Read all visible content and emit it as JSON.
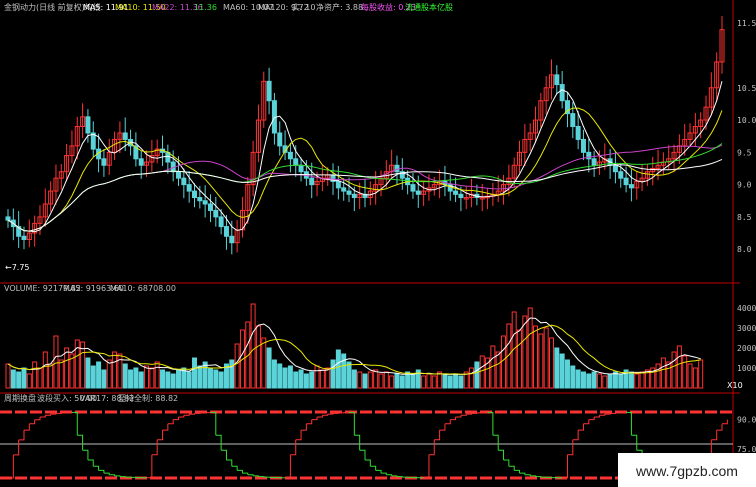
{
  "colors": {
    "bg": "#000000",
    "up": "#ff3333",
    "down": "#5ad3d9",
    "white_line": "#ffffff",
    "yellow_line": "#e8e800",
    "purple_line": "#cc44cc",
    "green_line": "#33dd33",
    "magenta_text": "#ff55ff",
    "green_text": "#33ff33",
    "red_axis": "#c00000",
    "grid": "#800000",
    "label_gray": "#c0c0c0"
  },
  "header_main": {
    "title": "金钢动力(日线 前复权)均线",
    "ma5": "MA5: 11.91",
    "ma10": "MA10: 11.50",
    "ma22": "MA22: 11.36",
    "ma30": "11.36",
    "ma60": "MA60: 10.07",
    "ma120": "MA120: 9.72",
    "extra1": "实: 10",
    "net_asset": "净资产: 3.88",
    "eps": "每股收益: 0.23",
    "float": "流通股本亿股"
  },
  "header_volume": {
    "volume": "VOLUME: 92179.82",
    "ma5": "MA5: 91963.60",
    "ma10": "MA10: 68708.00"
  },
  "header_indicator": {
    "name": "周期换盘",
    "buy": "波段买入: 50.00",
    "var": "VAR17: 88.82",
    "lock": "至持全制: 88.82"
  },
  "low_marker": "7.75",
  "watermark": "www.7gpzb.com",
  "chart_data": [
    {
      "type": "candlestick",
      "name": "price",
      "ylim": [
        7.6,
        11.55
      ],
      "y_ticks": [
        "11.5",
        "10.5",
        "10.0",
        "9.5",
        "9.0",
        "8.5",
        "8.0"
      ],
      "close": [
        8.45,
        8.35,
        8.2,
        8.15,
        8.25,
        8.4,
        8.5,
        8.7,
        8.9,
        9.1,
        9.2,
        9.45,
        9.6,
        9.9,
        10.05,
        9.8,
        9.55,
        9.4,
        9.3,
        9.5,
        9.7,
        9.8,
        9.7,
        9.6,
        9.4,
        9.3,
        9.35,
        9.45,
        9.55,
        9.5,
        9.35,
        9.2,
        9.1,
        9.0,
        8.9,
        8.8,
        8.75,
        8.7,
        8.6,
        8.5,
        8.35,
        8.2,
        8.1,
        8.3,
        8.6,
        9.0,
        9.5,
        10.0,
        10.6,
        10.3,
        9.8,
        9.6,
        9.5,
        9.4,
        9.3,
        9.2,
        9.1,
        9.0,
        9.05,
        9.1,
        9.15,
        9.05,
        8.95,
        8.9,
        8.85,
        8.8,
        8.85,
        8.8,
        8.9,
        9.0,
        9.1,
        9.2,
        9.3,
        9.2,
        9.1,
        9.0,
        8.9,
        8.85,
        8.9,
        8.95,
        9.0,
        9.05,
        9.0,
        8.9,
        8.85,
        8.8,
        8.8,
        8.85,
        8.8,
        8.8,
        8.82,
        8.85,
        8.9,
        9.0,
        9.1,
        9.3,
        9.5,
        9.7,
        9.8,
        10.0,
        10.3,
        10.5,
        10.7,
        10.55,
        10.3,
        10.1,
        9.9,
        9.7,
        9.5,
        9.4,
        9.3,
        9.35,
        9.4,
        9.3,
        9.2,
        9.1,
        9.0,
        8.95,
        9.05,
        9.1,
        9.2,
        9.25,
        9.3,
        9.35,
        9.4,
        9.5,
        9.6,
        9.7,
        9.8,
        9.9,
        10.0,
        10.2,
        10.5,
        10.9,
        11.4
      ]
    },
    {
      "type": "bar",
      "name": "volume",
      "ylim": [
        0,
        4600
      ],
      "y_ticks": [
        "4000",
        "3000",
        "2000",
        "1000"
      ],
      "values": [
        1200,
        900,
        800,
        1000,
        700,
        1300,
        1000,
        1800,
        1200,
        2600,
        1400,
        2000,
        1700,
        2400,
        2300,
        1500,
        1100,
        1300,
        900,
        1400,
        1800,
        1700,
        1200,
        900,
        1000,
        800,
        1100,
        1000,
        1300,
        900,
        800,
        700,
        900,
        1000,
        800,
        1500,
        1100,
        1300,
        1000,
        900,
        800,
        1200,
        1400,
        2200,
        2900,
        3300,
        4200,
        3100,
        2500,
        2000,
        1400,
        1200,
        1000,
        1100,
        800,
        900,
        700,
        800,
        1100,
        900,
        1000,
        1400,
        1900,
        1700,
        1300,
        900,
        800,
        700,
        800,
        900,
        700,
        800,
        600,
        700,
        600,
        800,
        700,
        900,
        600,
        700,
        600,
        800,
        700,
        600,
        700,
        600,
        800,
        1000,
        1300,
        1600,
        1500,
        2100,
        1800,
        2600,
        3200,
        3800,
        2900,
        3600,
        4000,
        3100,
        2700,
        3000,
        2500,
        2000,
        1700,
        1400,
        1100,
        900,
        800,
        700,
        800,
        700,
        600,
        700,
        800,
        700,
        900,
        800,
        700,
        800,
        900,
        1000,
        1200,
        1500,
        1300,
        1800,
        2100,
        1600,
        1200,
        1000,
        1400
      ]
    },
    {
      "type": "line",
      "name": "indicator",
      "ylim": [
        58,
        98
      ],
      "y_ticks": [
        "90.0",
        "75.0",
        "60.0"
      ]
    }
  ]
}
